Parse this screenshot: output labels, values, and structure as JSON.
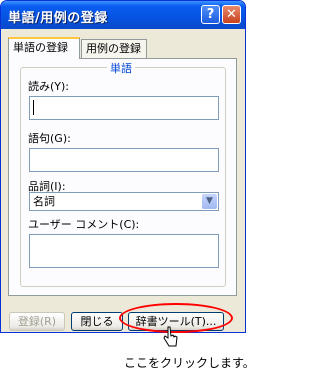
{
  "window": {
    "title": "単語/用例の登録",
    "help_label": "?",
    "close_label": "✕"
  },
  "tabs": [
    {
      "label": "単語の登録"
    },
    {
      "label": "用例の登録"
    }
  ],
  "group_title": "単語",
  "fields": {
    "reading_label": "読み(Y):",
    "reading_value": "",
    "phrase_label": "語句(G):",
    "phrase_value": "",
    "pos_label": "品詞(I):",
    "pos_value": "名詞",
    "comment_label": "ユーザー コメント(C):",
    "comment_value": ""
  },
  "buttons": {
    "register": "登録(R)",
    "close": "閉じる",
    "dict_tool": "辞書ツール(T)..."
  },
  "annotation": {
    "caption": "ここをクリックします。"
  }
}
